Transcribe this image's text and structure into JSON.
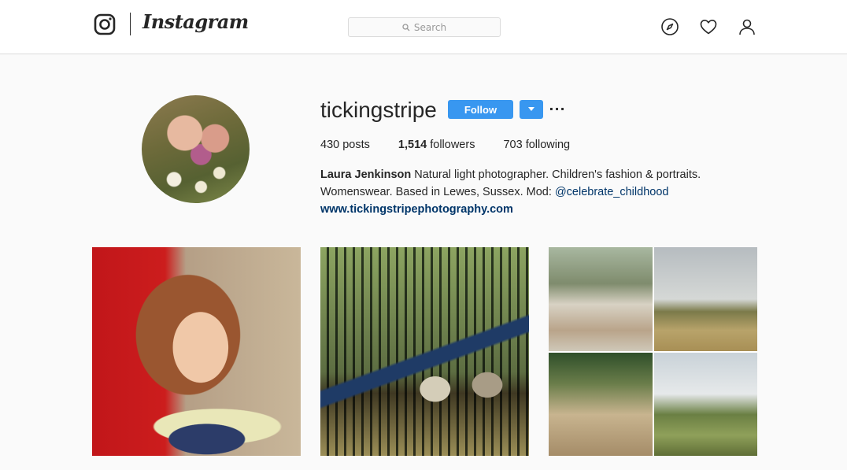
{
  "nav": {
    "brand": "Instagram",
    "search_placeholder": "Search",
    "icons": [
      "instagram-glyph-icon",
      "search-icon",
      "compass-icon",
      "heart-icon",
      "profile-icon"
    ]
  },
  "profile": {
    "username": "tickingstripe",
    "follow_label": "Follow",
    "more_label": "···",
    "stats": {
      "posts_count": "430",
      "posts_label": "posts",
      "followers_count": "1,514",
      "followers_label": "followers",
      "following_count": "703",
      "following_label": "following"
    },
    "bio": {
      "full_name": "Laura Jenkinson",
      "text_1": "Natural light photographer. Children's fashion & portraits. Womenswear. Based in Lewes, Sussex. Mod: ",
      "mention": "@celebrate_childhood",
      "website": "www.tickingstripephotography.com"
    }
  },
  "colors": {
    "accent": "#3897f0",
    "link": "#003569",
    "border": "#dbdbdb",
    "background": "#fafafa"
  }
}
